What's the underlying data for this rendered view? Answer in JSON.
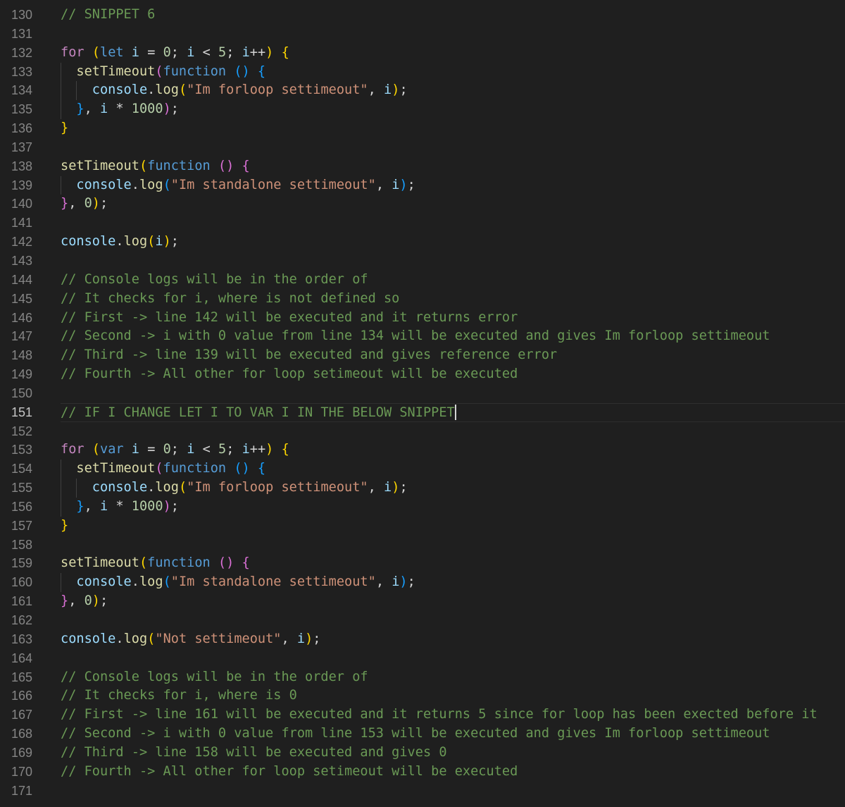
{
  "editor": {
    "line_numbers": [
      "130",
      "131",
      "132",
      "133",
      "134",
      "135",
      "136",
      "137",
      "138",
      "139",
      "140",
      "141",
      "142",
      "143",
      "144",
      "145",
      "146",
      "147",
      "148",
      "149",
      "150",
      "151",
      "152",
      "153",
      "154",
      "155",
      "156",
      "157",
      "158",
      "159",
      "160",
      "161",
      "162",
      "163",
      "164",
      "165",
      "166",
      "167",
      "168",
      "169",
      "170",
      "171"
    ],
    "current_line": "151",
    "snippet_comment": "// SNIPPET 6",
    "comments_block_1": [
      "// Console logs will be in the order of",
      "// It checks for i, where is not defined so",
      "// First -> line 142 will be executed and it returns error",
      "// Second -> i with 0 value from line 134 will be executed and gives Im forloop settimeout",
      "// Third -> line 139 will be executed and gives reference error",
      "// Fourth -> All other for loop setimeout will be executed"
    ],
    "change_comment": "// IF I CHANGE LET I TO VAR I IN THE BELOW SNIPPET",
    "comments_block_2": [
      "// Console logs will be in the order of",
      "// It checks for i, where is 0",
      "// First -> line 161 will be executed and it returns 5 since for loop has been exected before it",
      "// Second -> i with 0 value from line 153 will be executed and gives Im forloop settimeout",
      "// Third -> line 158 will be executed and gives 0",
      "// Fourth -> All other for loop setimeout will be executed"
    ],
    "strings": {
      "forloop": "\"Im forloop settimeout\"",
      "standalone": "\"Im standalone settimeout\"",
      "not_settimeout": "\"Not settimeout\""
    },
    "keywords": {
      "for": "for",
      "let": "let",
      "var": "var",
      "function": "function"
    },
    "identifiers": {
      "i": "i",
      "setTimeout": "setTimeout",
      "console": "console",
      "log": "log"
    },
    "numbers": {
      "zero": "0",
      "five": "5",
      "thousand": "1000"
    },
    "colors": {
      "background": "#1f1f1f",
      "comment": "#6a9955",
      "keyword": "#569cd6",
      "control": "#c586c0",
      "function": "#dcdcaa",
      "variable": "#9cdcfe",
      "string": "#ce9178",
      "number": "#b5cea8",
      "bracket_gold": "#ffd700",
      "bracket_orchid": "#da70d6",
      "bracket_blue": "#179fff",
      "line_number": "#858585"
    }
  }
}
